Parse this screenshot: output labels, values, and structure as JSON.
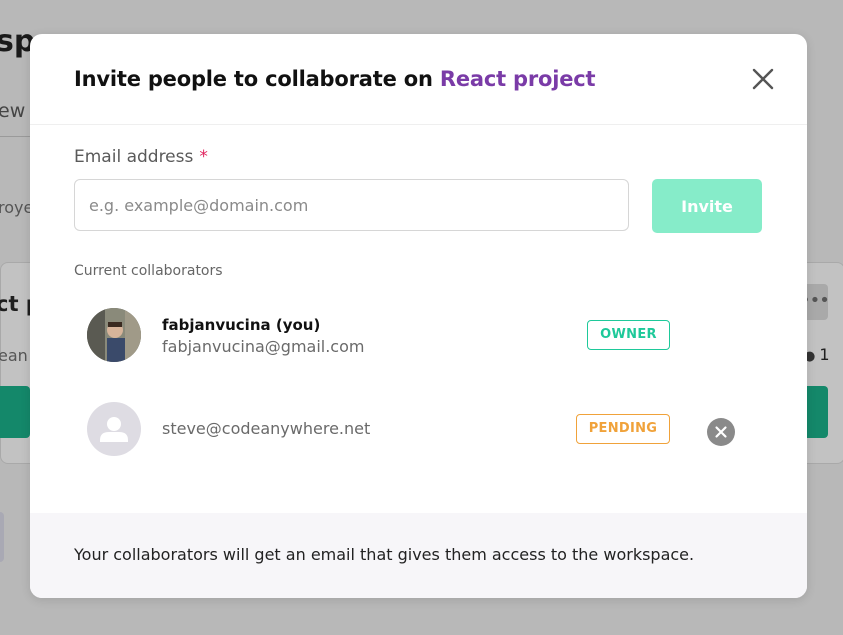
{
  "background": {
    "title_fragment": "spe",
    "tab_fragment": "ew",
    "project_fragment": "roye",
    "card_title_fragment": "ct p",
    "card_sub_fragment": "ean",
    "more_glyph": "•••",
    "member_count": "1"
  },
  "modal": {
    "title_prefix": "Invite people to collaborate on",
    "project_name": "React project",
    "close_icon": "close-icon",
    "email_label": "Email address",
    "required_mark": "*",
    "email_value": "",
    "email_placeholder": "e.g. example@domain.com",
    "invite_label": "Invite",
    "collaborators_heading": "Current collaborators",
    "collaborators": [
      {
        "name": "fabjanvucina (you)",
        "email": "fabjanvucina@gmail.com",
        "role": "OWNER",
        "avatar": "user-photo-avatar"
      },
      {
        "name": "",
        "email": "steve@codeanywhere.net",
        "role": "PENDING",
        "avatar": "default-user-avatar",
        "remove_icon": "remove-icon"
      }
    ],
    "footer_text": "Your collaborators will get an email that gives them access to the workspace."
  },
  "colors": {
    "accent_purple": "#7a3ba7",
    "invite_button": "#86ecc9",
    "owner_badge": "#1ec99a",
    "pending_badge": "#f0a23a",
    "required": "#e0245e"
  }
}
